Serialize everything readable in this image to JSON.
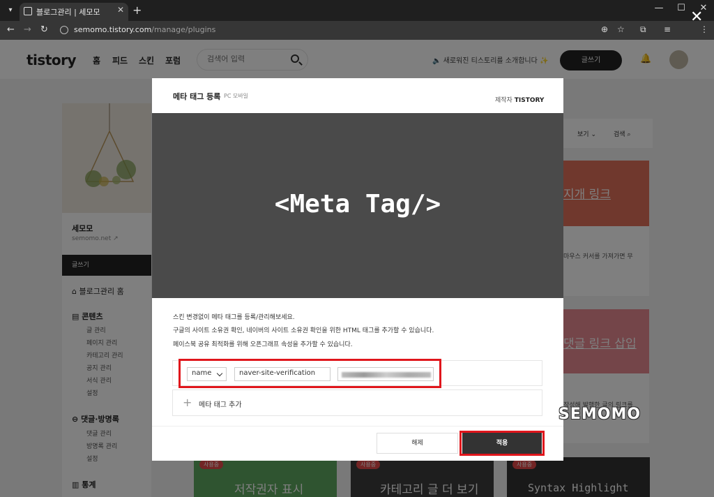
{
  "browser": {
    "tab_title": "블로그관리 | 세모모",
    "url_host": "semomo.tistory.com",
    "url_path": "/manage/plugins"
  },
  "header": {
    "logo": "tistory",
    "nav": [
      "홈",
      "피드",
      "스킨",
      "포럼"
    ],
    "search_placeholder": "검색어 입력",
    "notice": "새로워진 티스토리를 소개합니다 ✨",
    "write_button": "글쓰기"
  },
  "sidebar": {
    "blog_name": "세모모",
    "blog_url": "semomo.net",
    "write_button": "글쓰기",
    "home": "블로그관리 홈",
    "groups": [
      {
        "title": "콘텐츠",
        "items": [
          "글 관리",
          "페이지 관리",
          "카테고리 관리",
          "공지 관리",
          "서식 관리",
          "설정"
        ]
      },
      {
        "title": "댓글·방명록",
        "items": [
          "댓글 관리",
          "방명록 관리",
          "설정"
        ]
      },
      {
        "title": "통계",
        "items": []
      }
    ]
  },
  "main": {
    "view_label": "보기",
    "search_label": "검색",
    "cards": [
      {
        "title": "지개 링크",
        "text": "마우스 커서를 가져가면 무",
        "badge": ""
      },
      {
        "title": "댓글 링크 삽입",
        "text": "작성해 발행한 글의 링크를",
        "badge": ""
      },
      {
        "title": "저작권자 표시",
        "badge": "사용중"
      },
      {
        "title": "카테고리 글 더 보기",
        "badge": "사용중"
      },
      {
        "title": "Syntax Highlight",
        "badge": "사용중"
      }
    ]
  },
  "modal": {
    "title": "메타 태그 등록",
    "subtitle": "PC 모바일",
    "maker_label": "제작자",
    "maker_name": "TISTORY",
    "banner_text": "<Meta Tag/>",
    "descriptions": [
      "스킨 변경없이 메타 태그를 등록/관리해보세요.",
      "구글의 사이트 소유권 확인, 네이버의 사이트 소유권 확인을 위한 HTML 태그를 추가할 수 있습니다.",
      "페이스북 공유 최적화를 위해 오픈그래프 속성을 추가할 수 있습니다."
    ],
    "meta_row": {
      "type_selected": "name",
      "name_value": "naver-site-verification"
    },
    "add_label": "메타 태그 추가",
    "cancel_button": "해제",
    "apply_button": "적용"
  },
  "watermark": "SEMOMO",
  "colors": {
    "highlight": "#e0161c",
    "dark": "#333333",
    "banner": "#4a4a4a"
  }
}
